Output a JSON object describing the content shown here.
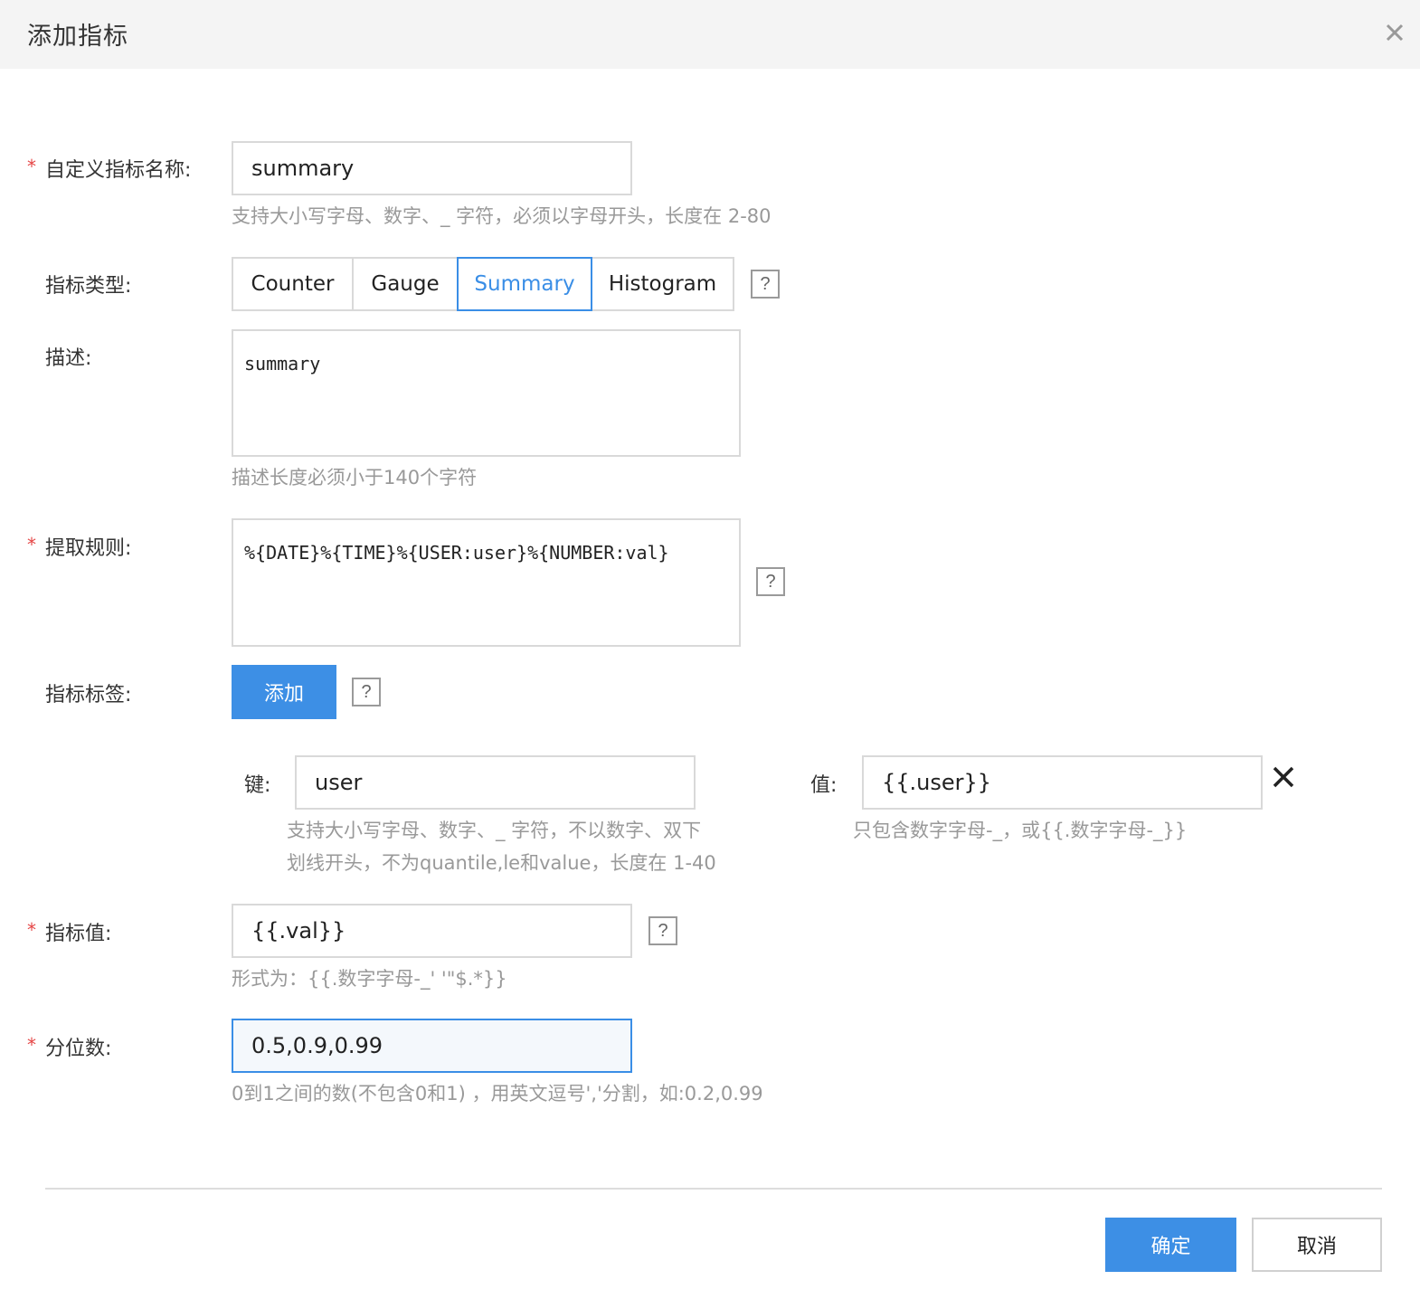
{
  "dialog": {
    "title": "添加指标"
  },
  "form": {
    "name": {
      "required_mark": "*",
      "label": "自定义指标名称:",
      "value": "summary",
      "hint": "支持大小写字母、数字、_ 字符，必须以字母开头，长度在 2-80"
    },
    "type": {
      "label": "指标类型:",
      "options": [
        "Counter",
        "Gauge",
        "Summary",
        "Histogram"
      ],
      "selected": "Summary",
      "help": "?"
    },
    "description": {
      "label": "描述:",
      "value": "summary",
      "hint": "描述长度必须小于140个字符"
    },
    "rule": {
      "required_mark": "*",
      "label": "提取规则:",
      "value": "%{DATE}%{TIME}%{USER:user}%{NUMBER:val}",
      "help": "?"
    },
    "tags": {
      "label": "指标标签:",
      "add_label": "添加",
      "help": "?",
      "items": [
        {
          "key_label": "键:",
          "key": "user",
          "key_hint_1": "支持大小写字母、数字、_ 字符，不以数字、双下",
          "key_hint_2": "划线开头，不为quantile,le和value，长度在 1-40",
          "value_label": "值:",
          "value": "{{.user}}",
          "value_hint": "只包含数字字母-_，或{{.数字字母-_}}"
        }
      ]
    },
    "metric_value": {
      "required_mark": "*",
      "label": "指标值:",
      "value": "{{.val}}",
      "help": "?",
      "hint": "形式为：{{.数字字母-_' '\"$.*}}"
    },
    "quantiles": {
      "required_mark": "*",
      "label": "分位数:",
      "value": "0.5,0.9,0.99",
      "hint": "0到1之间的数(不包含0和1) ，用英文逗号','分割，如:0.2,0.99"
    }
  },
  "footer": {
    "confirm": "确定",
    "cancel": "取消"
  },
  "colors": {
    "primary": "#3d8fe5",
    "required": "#e54545",
    "hint": "#999999",
    "border": "#d9d9d9"
  }
}
